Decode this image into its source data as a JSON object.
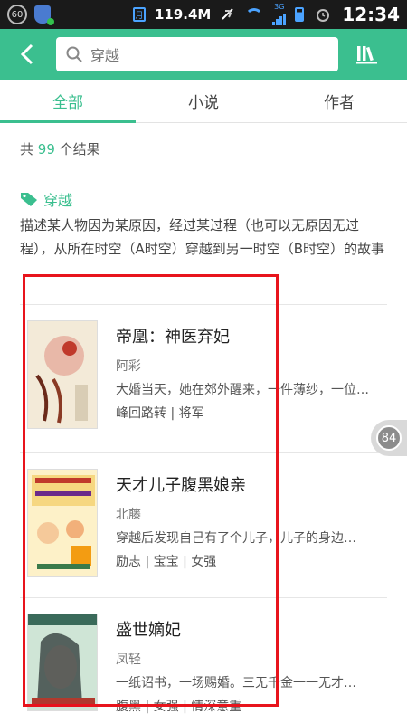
{
  "status_bar": {
    "notification_count": "60",
    "sim_label": "月",
    "net_speed": "119.4M",
    "signal_type": "3G",
    "time": "12:34"
  },
  "header": {
    "back_icon": "chevron-left-icon",
    "search_placeholder": "穿越",
    "search_value": "穿越",
    "shelf_icon": "bookshelf-icon"
  },
  "tabs": [
    {
      "label": "全部",
      "active": true
    },
    {
      "label": "小说",
      "active": false
    },
    {
      "label": "作者",
      "active": false
    }
  ],
  "results": {
    "prefix": "共",
    "count": "99",
    "suffix": "个结果"
  },
  "tag": {
    "name": "穿越",
    "description": "描述某人物因为某原因，经过某过程（也可以无原因无过程），从所在时空（A时空）穿越到另一时空（B时空）的故事"
  },
  "books": [
    {
      "title": "帝凰：神医弃妃",
      "author": "阿彩",
      "summary": "大婚当天，她在郊外醒来，一件薄纱，一位…",
      "tags": "峰回路转 | 将军"
    },
    {
      "title": "天才儿子腹黑娘亲",
      "author": "北藤",
      "summary": "穿越后发现自己有了个儿子，儿子的身边…",
      "tags": "励志 | 宝宝 | 女强"
    },
    {
      "title": "盛世嫡妃",
      "author": "凤轻",
      "summary": "一纸诏书，一场赐婚。三无千金一一无才…",
      "tags": "腹黑 | 女强 | 情深意重"
    }
  ],
  "side_count": "84",
  "colors": {
    "accent": "#3bbf8f",
    "highlight": "#e8141c"
  }
}
